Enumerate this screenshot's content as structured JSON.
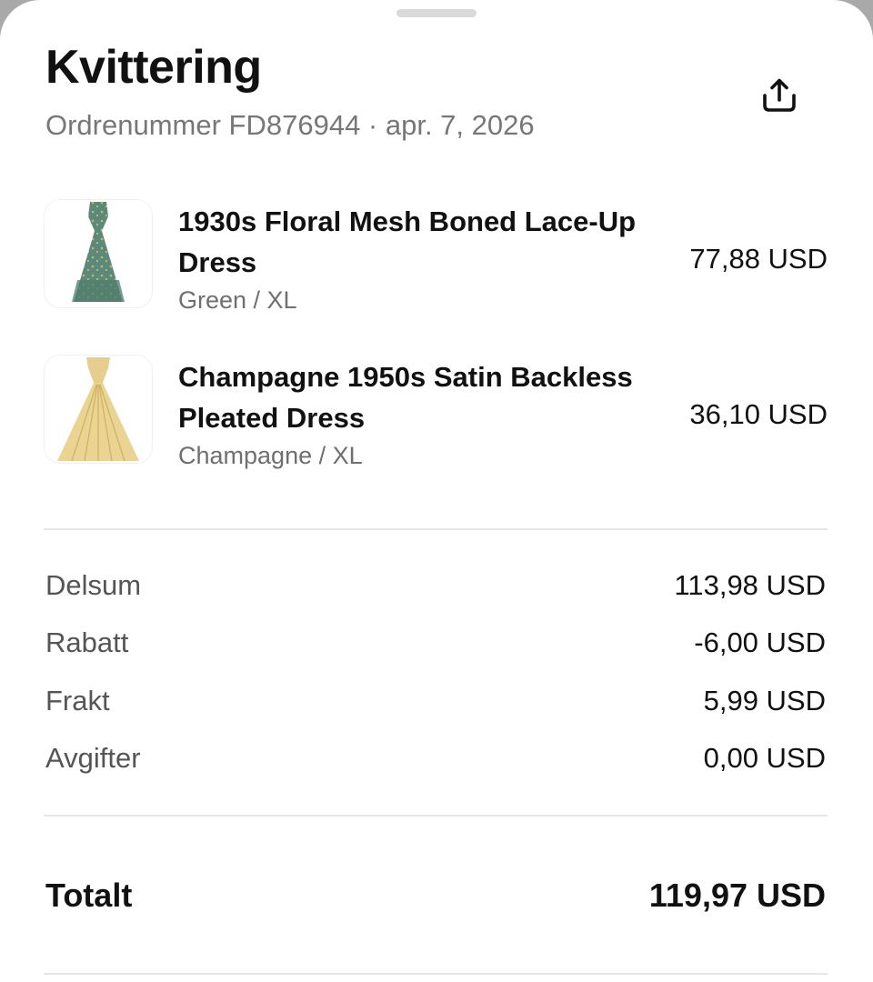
{
  "receipt": {
    "title": "Kvittering",
    "subtitle": "Ordrenummer FD876944 · apr. 7, 2026",
    "share_icon": "share-upload-icon"
  },
  "items": [
    {
      "name": "1930s Floral Mesh Boned Lace-Up Dress",
      "variant": "Green / XL",
      "price": "77,88 USD",
      "image_color": "#5c8a7a"
    },
    {
      "name": "Champagne 1950s Satin Backless Pleated Dress",
      "variant": "Champagne / XL",
      "price": "36,10 USD",
      "image_color": "#e6cf8e"
    }
  ],
  "summary": {
    "rows": [
      {
        "label": "Delsum",
        "value": "113,98 USD"
      },
      {
        "label": "Rabatt",
        "value": "-6,00 USD"
      },
      {
        "label": "Frakt",
        "value": "5,99 USD"
      },
      {
        "label": "Avgifter",
        "value": "0,00 USD"
      }
    ],
    "total_label": "Totalt",
    "total_value": "119,97 USD"
  }
}
